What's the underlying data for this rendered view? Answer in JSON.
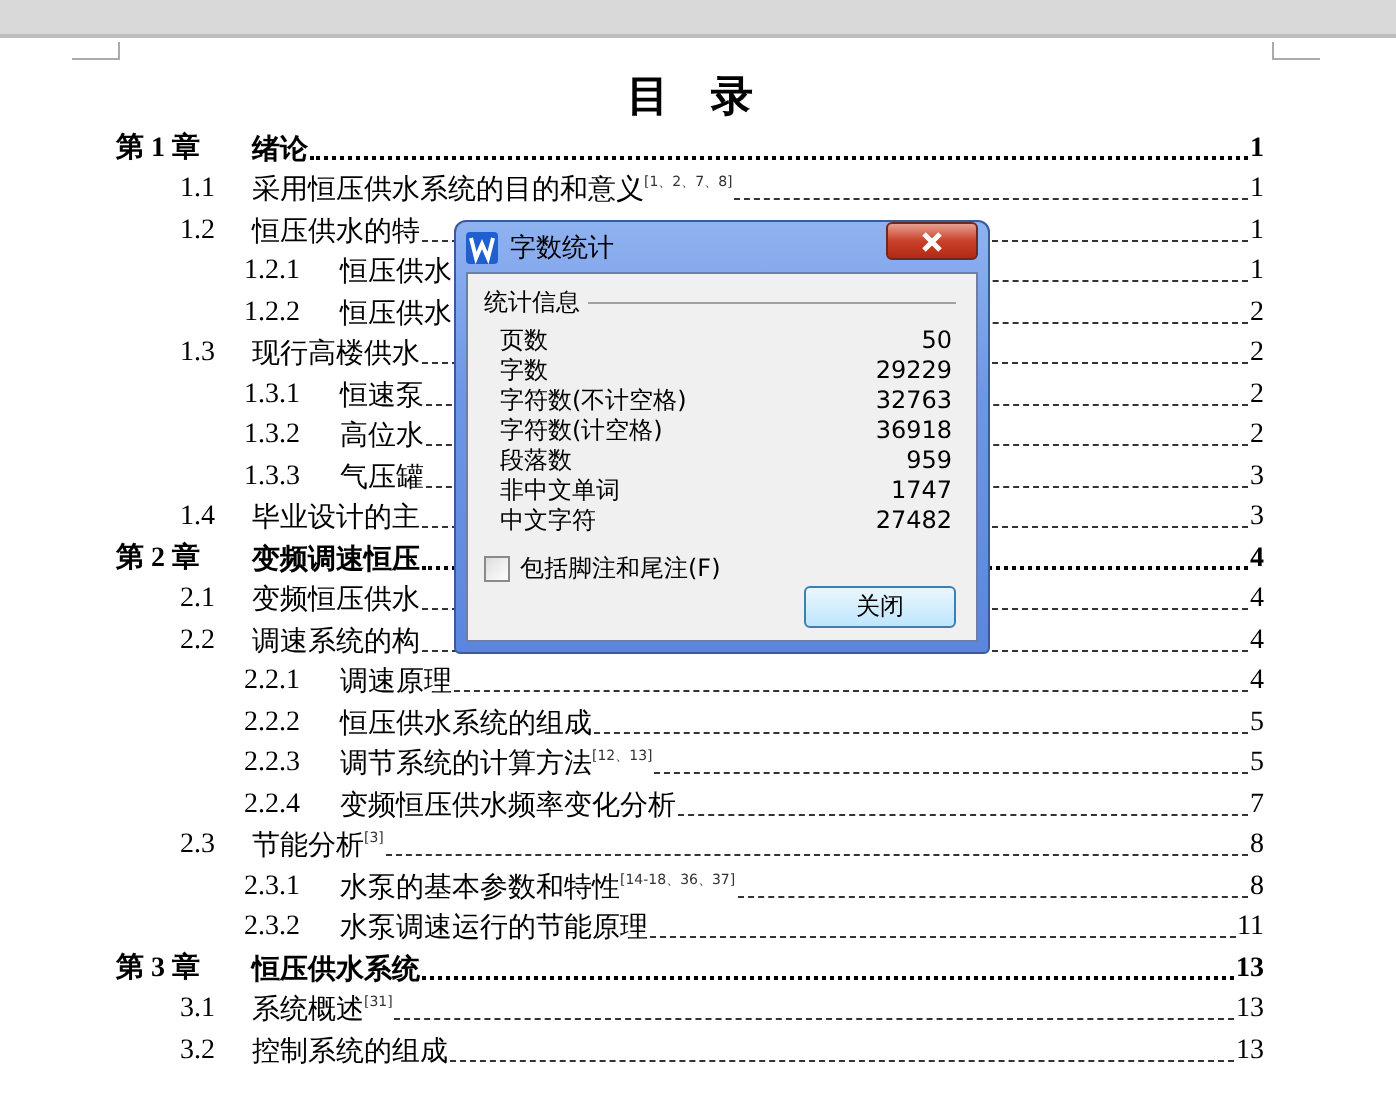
{
  "document": {
    "title": "目 录",
    "toc": [
      {
        "kind": "chapter",
        "number": "第 1 章",
        "title": "绪论",
        "page": "1"
      },
      {
        "kind": "section",
        "number": "1.1",
        "title": "采用恒压供水系统的目的和意义$^{[1、2、7、8]}$",
        "page": "1"
      },
      {
        "kind": "section",
        "number": "1.2",
        "title": "恒压供水的特",
        "page": "1"
      },
      {
        "kind": "subsection",
        "number": "1.2.1",
        "title": "恒压供水",
        "page": "1"
      },
      {
        "kind": "subsection",
        "number": "1.2.2",
        "title": "恒压供水",
        "page": "2"
      },
      {
        "kind": "section",
        "number": "1.3",
        "title": "现行高楼供水",
        "page": "2"
      },
      {
        "kind": "subsection",
        "number": "1.3.1",
        "title": "恒速泵",
        "page": "2"
      },
      {
        "kind": "subsection",
        "number": "1.3.2",
        "title": "高位水",
        "page": "2"
      },
      {
        "kind": "subsection",
        "number": "1.3.3",
        "title": "气压罐",
        "page": "3"
      },
      {
        "kind": "section",
        "number": "1.4",
        "title": "毕业设计的主",
        "page": "3"
      },
      {
        "kind": "chapter",
        "number": "第 2 章",
        "title": "变频调速恒压",
        "page": "4"
      },
      {
        "kind": "section",
        "number": "2.1",
        "title": "变频恒压供水",
        "page": "4"
      },
      {
        "kind": "section",
        "number": "2.2",
        "title": "调速系统的构",
        "page": "4"
      },
      {
        "kind": "subsection",
        "number": "2.2.1",
        "title": "调速原理",
        "page": "4"
      },
      {
        "kind": "subsection",
        "number": "2.2.2",
        "title": "恒压供水系统的组成",
        "page": "5"
      },
      {
        "kind": "subsection",
        "number": "2.2.3",
        "title": "调节系统的计算方法$^{[12、13]}$",
        "page": "5"
      },
      {
        "kind": "subsection",
        "number": "2.2.4",
        "title": "变频恒压供水频率变化分析",
        "page": "7"
      },
      {
        "kind": "section",
        "number": "2.3",
        "title": "节能分析$^{[3]}$",
        "page": "8"
      },
      {
        "kind": "subsection",
        "number": "2.3.1",
        "title": "水泵的基本参数和特性$^{[14-18、36、37]}$",
        "page": "8"
      },
      {
        "kind": "subsection",
        "number": "2.3.2",
        "title": "水泵调速运行的节能原理",
        "page": "11"
      },
      {
        "kind": "chapter",
        "number": "第 3 章",
        "title": "恒压供水系统",
        "page": "13"
      },
      {
        "kind": "section",
        "number": "3.1",
        "title": "系统概述$^{[31]}$",
        "page": "13"
      },
      {
        "kind": "section",
        "number": "3.2",
        "title": "控制系统的组成",
        "page": "13"
      }
    ]
  },
  "dialog": {
    "title": "字数统计",
    "group_label": "统计信息",
    "stats": [
      {
        "label": "页数",
        "value": "50"
      },
      {
        "label": "字数",
        "value": "29229"
      },
      {
        "label": "字符数(不计空格)",
        "value": "32763"
      },
      {
        "label": "字符数(计空格)",
        "value": "36918"
      },
      {
        "label": "段落数",
        "value": "959"
      },
      {
        "label": "非中文单词",
        "value": "1747"
      },
      {
        "label": "中文字符",
        "value": "27482"
      }
    ],
    "checkbox": {
      "label": "包括脚注和尾注(F)",
      "checked": false
    },
    "button": "关闭"
  }
}
